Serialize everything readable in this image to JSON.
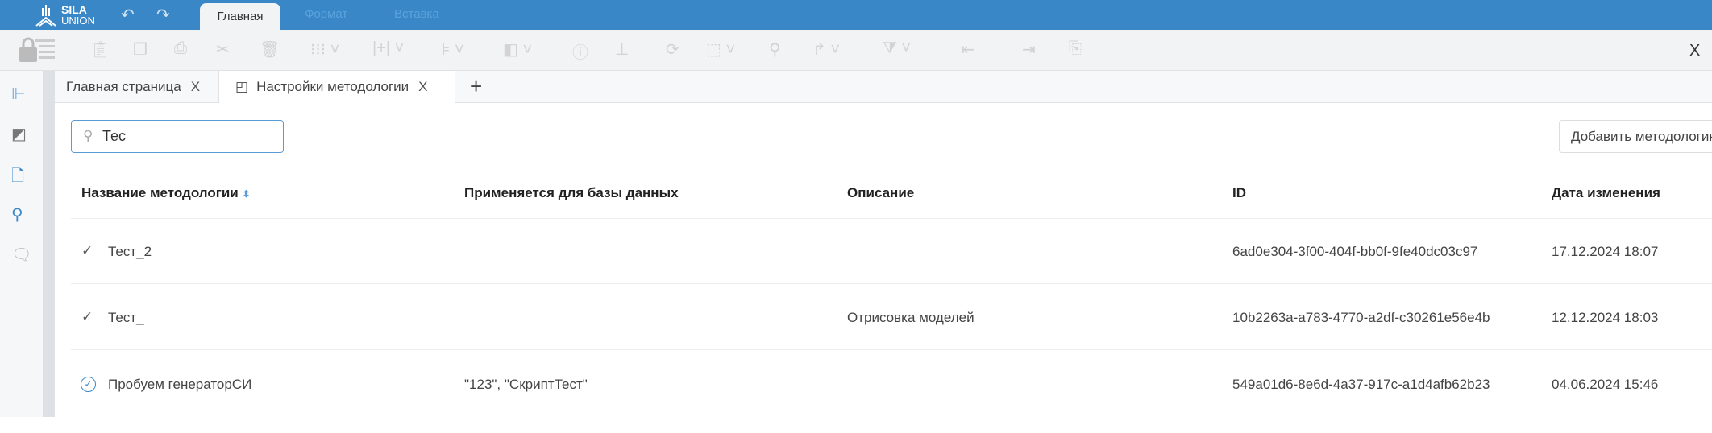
{
  "app": {
    "logo_line1": "SILA",
    "logo_line2": "UNION",
    "accent": "#3a87c8"
  },
  "ribbon": {
    "tabs": [
      {
        "label": "Главная",
        "active": true
      },
      {
        "label": "Формат",
        "active": false
      },
      {
        "label": "Вставка",
        "active": false
      }
    ],
    "undo_icon": "undo-icon",
    "redo_icon": "redo-icon"
  },
  "toolbar": {
    "icons": [
      "lock-list",
      "clipboard",
      "copy",
      "print",
      "cut",
      "delete",
      "grid",
      "insert-column",
      "align",
      "layers",
      "info",
      "hierarchy",
      "refresh",
      "select",
      "search",
      "redo",
      "filter-clear",
      "indent-left",
      "indent-right",
      "paste-special"
    ],
    "close_label": "X"
  },
  "sidebar": {
    "icons": [
      "tree-icon",
      "shapes-icon",
      "document-icon",
      "search-icon",
      "comments-icon"
    ]
  },
  "doc_tabs": [
    {
      "label": "Главная страница",
      "close": "X"
    },
    {
      "label": "Настройки методологии",
      "close": "X"
    }
  ],
  "add_tab_label": "+",
  "search": {
    "value": "Тес"
  },
  "add_button": "Добавить методологию",
  "table": {
    "columns": [
      "Название методологии",
      "Применяется для базы данных",
      "Описание",
      "ID",
      "Дата изменения"
    ],
    "sort_column": "Название методологии",
    "rows": [
      {
        "status": "check",
        "name": "Тест_2",
        "db": "",
        "description": "",
        "id": "6ad0e304-3f00-404f-bb0f-9fe40dc03c97",
        "date": "17.12.2024 18:07"
      },
      {
        "status": "check",
        "name": "Тест_",
        "db": "",
        "description": "Отрисовка моделей",
        "id": "10b2263a-a783-4770-a2df-c30261e56e4b",
        "date": "12.12.2024 18:03"
      },
      {
        "status": "active",
        "name": "Пробуем генераторСИ",
        "db": "\"123\", \"СкриптТест\"",
        "description": "",
        "id": "549a01d6-8e6d-4a37-917c-a1d4afb62b23",
        "date": "04.06.2024 15:46"
      }
    ]
  }
}
